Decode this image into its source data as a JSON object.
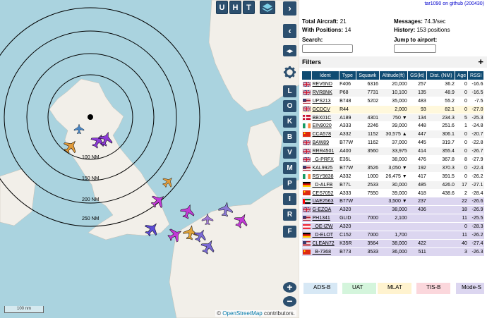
{
  "map": {
    "ring_labels": [
      "100 NM",
      "150 NM",
      "200 NM",
      "250 NM"
    ],
    "scale_label": "100 nm",
    "attribution_prefix": "© ",
    "attribution_link": "OpenStreetMap",
    "attribution_suffix": " contributors.",
    "top_buttons": [
      "U",
      "H",
      "T"
    ],
    "side_letters": [
      "L",
      "O",
      "K",
      "B",
      "V",
      "M",
      "P",
      "I",
      "R",
      "F"
    ],
    "zoom_in": "+",
    "zoom_out": "−"
  },
  "panel": {
    "github_link": "tar1090 on github (200430)",
    "total_aircraft_label": "Total Aircraft:",
    "total_aircraft": "21",
    "with_positions_label": "With Positions:",
    "with_positions": "14",
    "messages_label": "Messages:",
    "messages": "74.3/sec",
    "history_label": "History:",
    "history": "153 positions",
    "search_label": "Search:",
    "jump_label": "Jump to airport:",
    "filters_label": "Filters",
    "filters_plus": "+"
  },
  "table": {
    "headers": [
      "Ident",
      "Type",
      "Squawk",
      "Altitude(ft)",
      "GS(kt)",
      "Dist. (NM)",
      "Age",
      "RSSI"
    ],
    "rows": [
      {
        "flag": "uk",
        "ident": "REV6ND",
        "type": "F406",
        "squawk": "6316",
        "alt": "20,000",
        "gs": "257",
        "dist": "36.2",
        "age": "0",
        "rssi": "-16.6",
        "cls": "normal"
      },
      {
        "flag": "uk",
        "ident": "RVR8NK",
        "type": "P68",
        "squawk": "7731",
        "alt": "10,100",
        "gs": "135",
        "dist": "48.9",
        "age": "0",
        "rssi": "-16.5",
        "cls": "alt"
      },
      {
        "flag": "us",
        "ident": "UPS213",
        "type": "B748",
        "squawk": "5202",
        "alt": "35,000",
        "gs": "483",
        "dist": "55.2",
        "age": "0",
        "rssi": "-7.5",
        "cls": "normal"
      },
      {
        "flag": "uk",
        "ident": "GCDCV",
        "type": "R44",
        "squawk": "",
        "alt": "2,000",
        "gs": "93",
        "dist": "82.1",
        "age": "0",
        "rssi": "-27.0",
        "cls": "mlat"
      },
      {
        "flag": "dk",
        "ident": "BBX01C",
        "type": "A189",
        "squawk": "4301",
        "alt": "750 ▼",
        "gs": "134",
        "dist": "234.3",
        "age": "5",
        "rssi": "-25.3",
        "cls": "alt"
      },
      {
        "flag": "ie",
        "ident": "EIN9020",
        "type": "A333",
        "squawk": "2246",
        "alt": "39,000",
        "gs": "448",
        "dist": "251.6",
        "age": "1",
        "rssi": "-24.8",
        "cls": "normal"
      },
      {
        "flag": "cn",
        "ident": "CCA578",
        "type": "A332",
        "squawk": "1152",
        "alt": "30,575 ▲",
        "gs": "447",
        "dist": "306.1",
        "age": "0",
        "rssi": "-20.7",
        "cls": "alt"
      },
      {
        "flag": "uk",
        "ident": "BAW89",
        "type": "B77W",
        "squawk": "1162",
        "alt": "37,000",
        "gs": "445",
        "dist": "319.7",
        "age": "0",
        "rssi": "-22.8",
        "cls": "normal"
      },
      {
        "flag": "uk",
        "ident": "RRR4501",
        "type": "A400",
        "squawk": "3560",
        "alt": "33,975",
        "gs": "414",
        "dist": "355.4",
        "age": "0",
        "rssi": "-26.7",
        "cls": "alt"
      },
      {
        "flag": "uk",
        "ident": "_G-PRFX",
        "type": "E35L",
        "squawk": "",
        "alt": "38,000",
        "gs": "476",
        "dist": "367.8",
        "age": "8",
        "rssi": "-27.9",
        "cls": "normal"
      },
      {
        "flag": "us",
        "ident": "KAL9925",
        "type": "B77W",
        "squawk": "3526",
        "alt": "3,050 ▼",
        "gs": "192",
        "dist": "370.3",
        "age": "0",
        "rssi": "-22.4",
        "cls": "alt"
      },
      {
        "flag": "ie",
        "ident": "RSY9838",
        "type": "A332",
        "squawk": "1000",
        "alt": "26,475 ▼",
        "gs": "417",
        "dist": "391.5",
        "age": "0",
        "rssi": "-26.2",
        "cls": "normal"
      },
      {
        "flag": "de",
        "ident": "_D-ALFB",
        "type": "B77L",
        "squawk": "2533",
        "alt": "30,000",
        "gs": "485",
        "dist": "426.0",
        "age": "17",
        "rssi": "-27.1",
        "cls": "alt"
      },
      {
        "flag": "cn",
        "ident": "CES7052",
        "type": "A333",
        "squawk": "7550",
        "alt": "39,000",
        "gs": "418",
        "dist": "438.6",
        "age": "2",
        "rssi": "-28.4",
        "cls": "normal"
      },
      {
        "flag": "ae",
        "ident": "UAE2563",
        "type": "B77W",
        "squawk": "",
        "alt": "3,500 ▼",
        "gs": "237",
        "dist": "",
        "age": "22",
        "rssi": "-26.6",
        "cls": "modes"
      },
      {
        "flag": "uk",
        "ident": "G-EZOA",
        "type": "A320",
        "squawk": "",
        "alt": "38,000",
        "gs": "436",
        "dist": "",
        "age": "18",
        "rssi": "-26.9",
        "cls": "modes"
      },
      {
        "flag": "us",
        "ident": "PH1341",
        "type": "GLID",
        "squawk": "7000",
        "alt": "2,100",
        "gs": "",
        "dist": "",
        "age": "11",
        "rssi": "-25.5",
        "cls": "modes"
      },
      {
        "flag": "at",
        "ident": "_OE-IZW",
        "type": "A320",
        "squawk": "",
        "alt": "",
        "gs": "",
        "dist": "",
        "age": "0",
        "rssi": "-28.3",
        "cls": "modes"
      },
      {
        "flag": "de",
        "ident": "_D-ELOT",
        "type": "C152",
        "squawk": "7000",
        "alt": "1,700",
        "gs": "",
        "dist": "",
        "age": "11",
        "rssi": "-26.2",
        "cls": "modes"
      },
      {
        "flag": "us",
        "ident": "CLEAN72",
        "type": "K35R",
        "squawk": "3564",
        "alt": "38,000",
        "gs": "422",
        "dist": "",
        "age": "40",
        "rssi": "-27.4",
        "cls": "modes"
      },
      {
        "flag": "cn",
        "ident": "_B-7368",
        "type": "B773",
        "squawk": "3533",
        "alt": "36,000",
        "gs": "511",
        "dist": "",
        "age": "3",
        "rssi": "-26.3",
        "cls": "modes"
      }
    ]
  },
  "legend": [
    {
      "label": "ADS-B",
      "color": "#d7e8f5"
    },
    {
      "label": "UAT",
      "color": "#d4f5dc"
    },
    {
      "label": "MLAT",
      "color": "#fff3cf"
    },
    {
      "label": "TIS-B",
      "color": "#fbd7dc"
    },
    {
      "label": "Mode-S",
      "color": "#dcd6f0"
    }
  ],
  "colors": {
    "sea": "#aad3df",
    "land": "#f2efe9",
    "header": "#0f4b72",
    "button": "#2c4f6e"
  }
}
